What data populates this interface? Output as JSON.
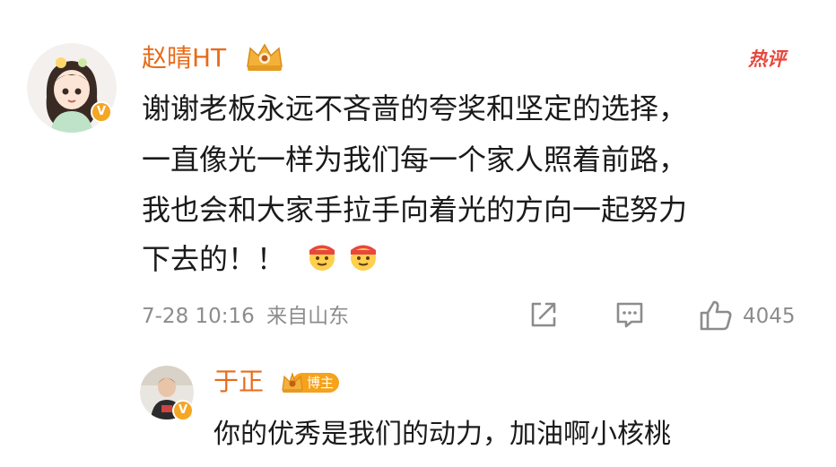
{
  "comment": {
    "username": "赵晴HT",
    "hot_label": "热评",
    "lines": [
      "谢谢老板永远不吝啬的夸奖和坚定的选择，",
      "一直像光一样为我们每一个家人照着前路，",
      "我也会和大家手拉手向着光的方向一起努力",
      "下去的！！"
    ],
    "emojis": [
      "hard-work-emoji",
      "hard-work-emoji"
    ],
    "timestamp": "7-28 10:16",
    "location": "来自山东",
    "like_count": "4045"
  },
  "reply": {
    "username": "于正",
    "role_badge": "博主",
    "text": "你的优秀是我们的动力，加油啊小核桃"
  },
  "colors": {
    "username": "#e86b1a",
    "hot": "#e8473d",
    "meta": "#8c8c8c",
    "verified": "#f5a623",
    "blogger_badge": "#f6a21a"
  }
}
